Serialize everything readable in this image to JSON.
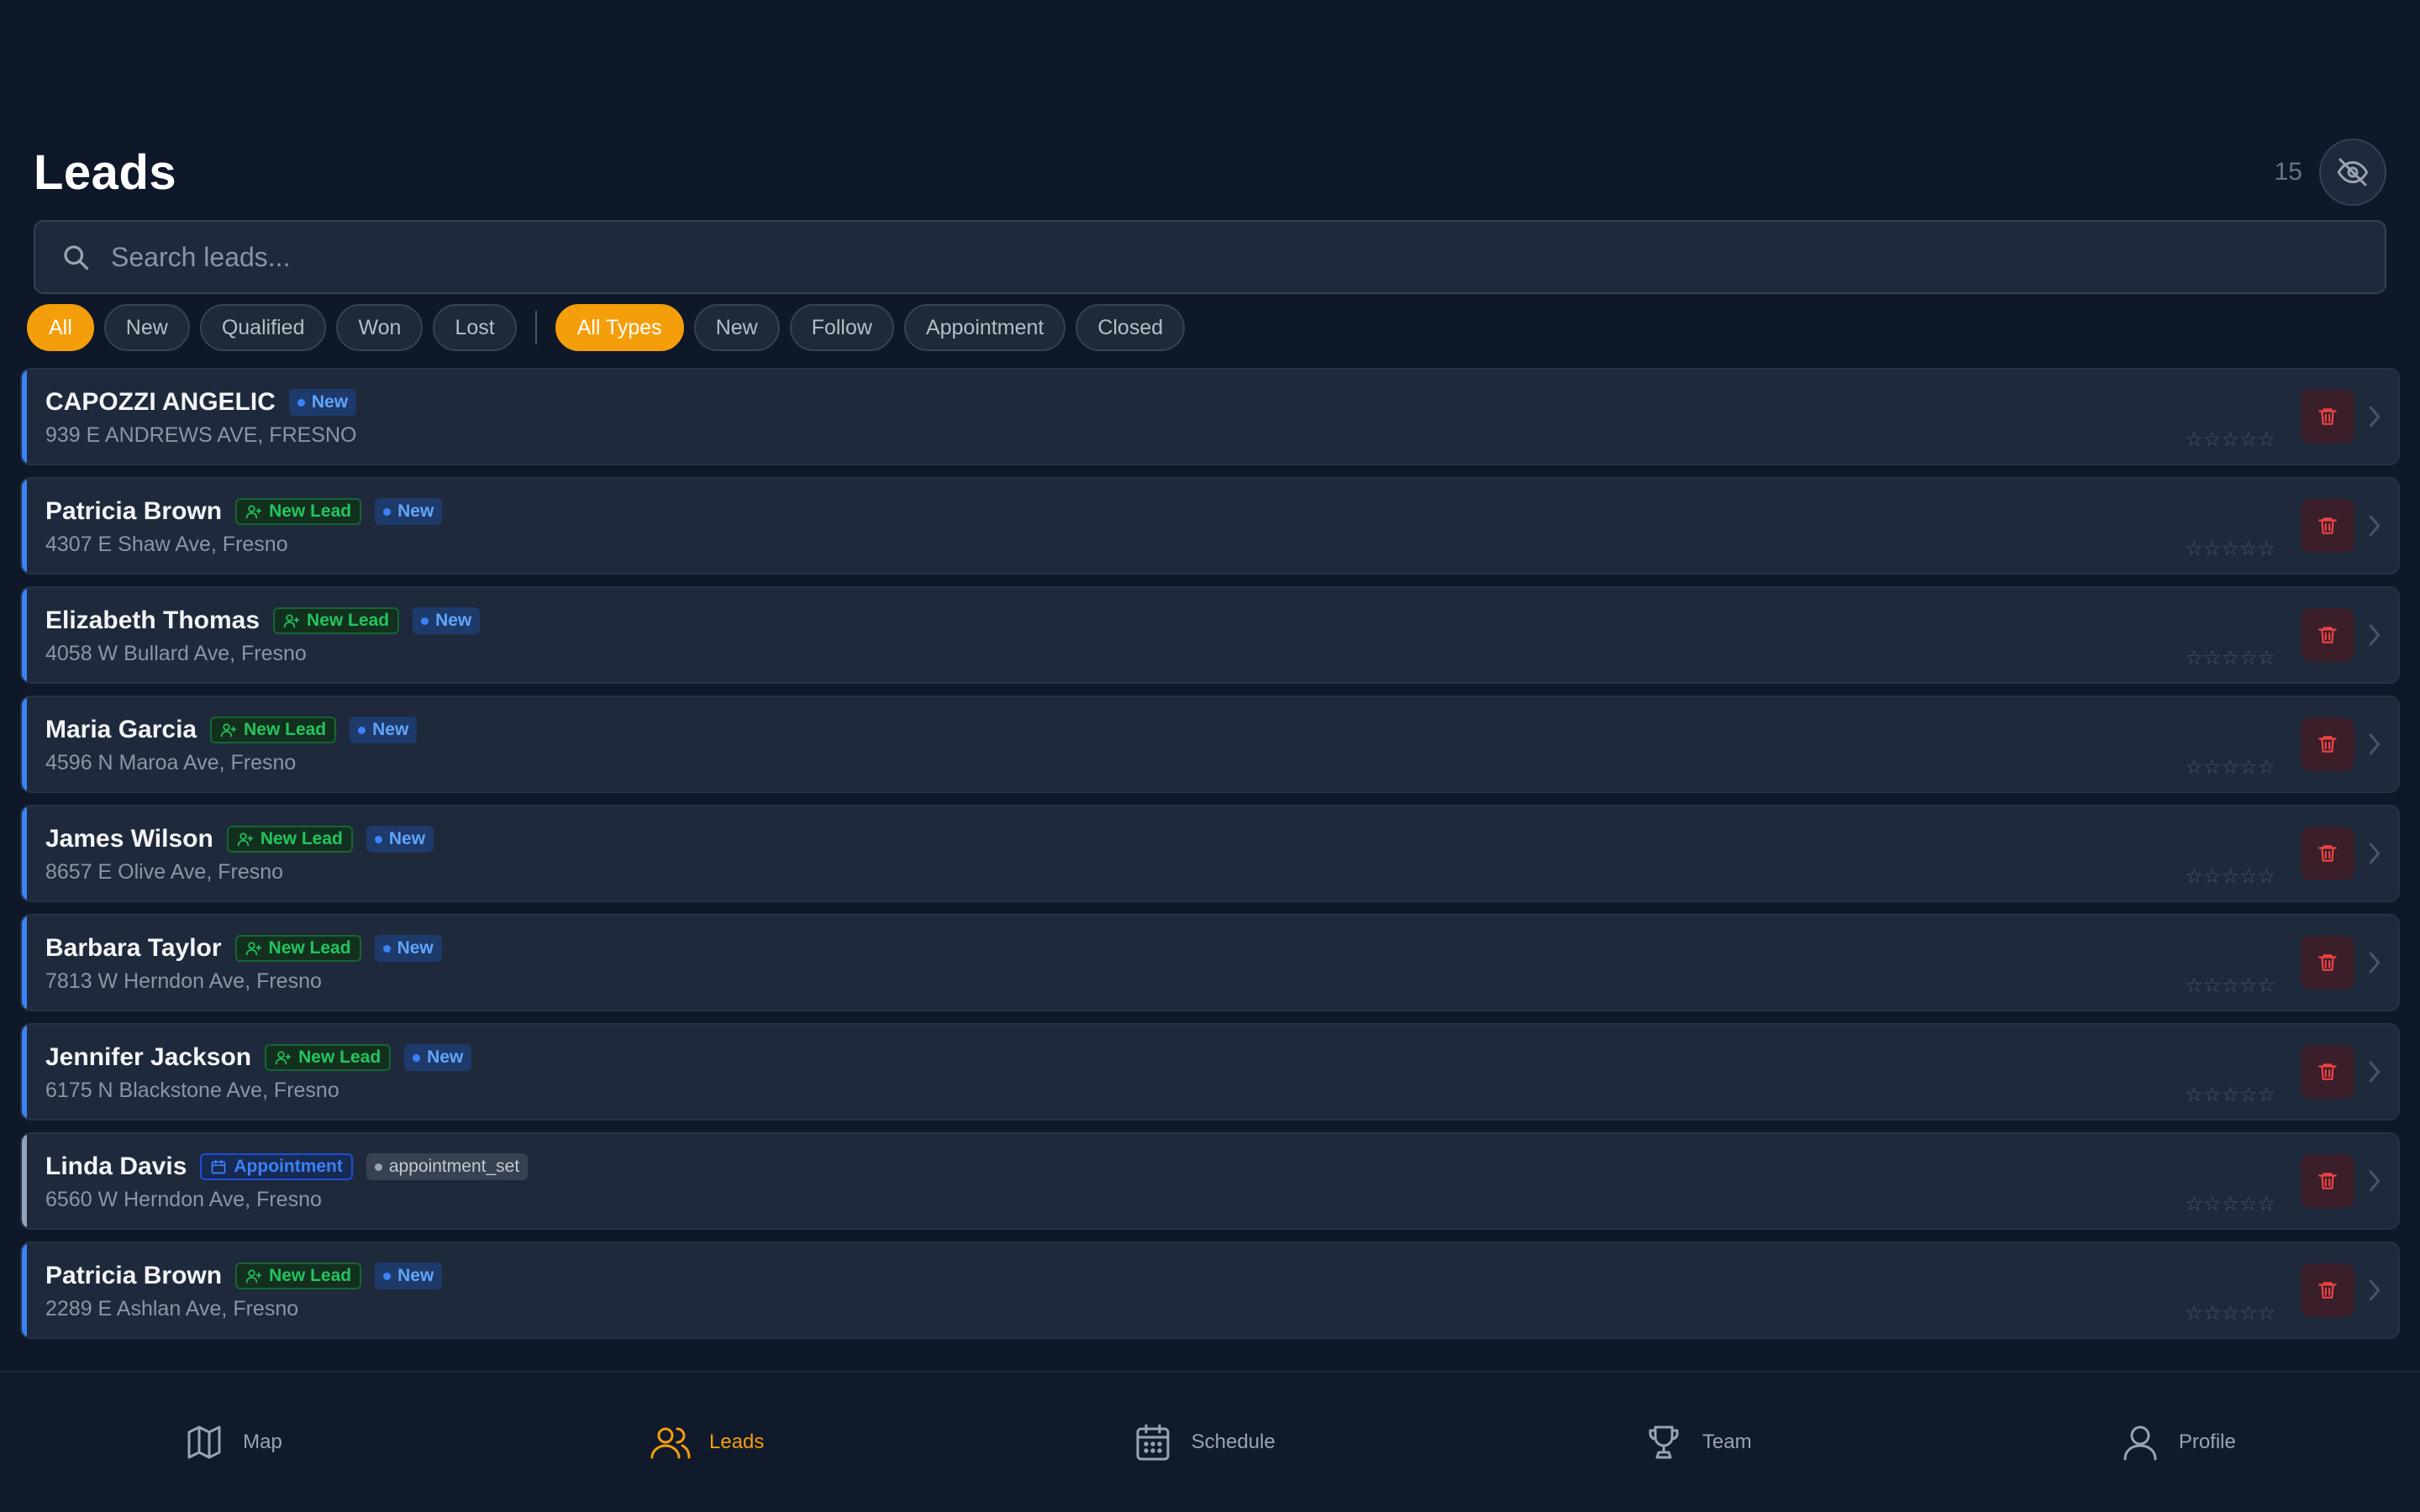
{
  "header": {
    "title": "Leads",
    "count": "15",
    "visibility_icon": "eye-off-icon"
  },
  "search": {
    "placeholder": "Search leads...",
    "value": ""
  },
  "status_filters": [
    {
      "label": "All",
      "active": true
    },
    {
      "label": "New",
      "active": false
    },
    {
      "label": "Qualified",
      "active": false
    },
    {
      "label": "Won",
      "active": false
    },
    {
      "label": "Lost",
      "active": false
    }
  ],
  "type_filters": [
    {
      "label": "All Types",
      "active": true
    },
    {
      "label": "New",
      "active": false
    },
    {
      "label": "Follow",
      "active": false
    },
    {
      "label": "Appointment",
      "active": false
    },
    {
      "label": "Closed",
      "active": false
    }
  ],
  "leads": [
    {
      "name": "CAPOZZI ANGELIC",
      "type_tag": "",
      "status": "New",
      "address": "939 E ANDREWS AVE, FRESNO",
      "rating": 0
    },
    {
      "name": "Patricia Brown",
      "type_tag": "New Lead",
      "status": "New",
      "address": "4307 E Shaw Ave, Fresno",
      "rating": 0
    },
    {
      "name": "Elizabeth Thomas",
      "type_tag": "New Lead",
      "status": "New",
      "address": "4058 W Bullard Ave, Fresno",
      "rating": 0
    },
    {
      "name": "Maria Garcia",
      "type_tag": "New Lead",
      "status": "New",
      "address": "4596 N Maroa Ave, Fresno",
      "rating": 0
    },
    {
      "name": "James Wilson",
      "type_tag": "New Lead",
      "status": "New",
      "address": "8657 E Olive Ave, Fresno",
      "rating": 0
    },
    {
      "name": "Barbara Taylor",
      "type_tag": "New Lead",
      "status": "New",
      "address": "7813 W Herndon Ave, Fresno",
      "rating": 0
    },
    {
      "name": "Jennifer Jackson",
      "type_tag": "New Lead",
      "status": "New",
      "address": "6175 N Blackstone Ave, Fresno",
      "rating": 0
    },
    {
      "name": "Linda Davis",
      "type_tag": "Appointment",
      "status": "appointment_set",
      "address": "6560 W Herndon Ave, Fresno",
      "rating": 0
    },
    {
      "name": "Patricia Brown",
      "type_tag": "New Lead",
      "status": "New",
      "address": "2289 E Ashlan Ave, Fresno",
      "rating": 0
    }
  ],
  "star_glyphs": "☆☆☆☆☆",
  "nav": [
    {
      "label": "Map",
      "icon": "map-icon",
      "active": false
    },
    {
      "label": "Leads",
      "icon": "users-icon",
      "active": true
    },
    {
      "label": "Schedule",
      "icon": "calendar-icon",
      "active": false
    },
    {
      "label": "Team",
      "icon": "trophy-icon",
      "active": false
    },
    {
      "label": "Profile",
      "icon": "user-icon",
      "active": false
    }
  ],
  "colors": {
    "accent": "#f59e0b",
    "new_blue": "#3b82f6",
    "new_lead_green": "#22c55e",
    "delete_red": "#ef4444",
    "bg": "#0f1829"
  }
}
